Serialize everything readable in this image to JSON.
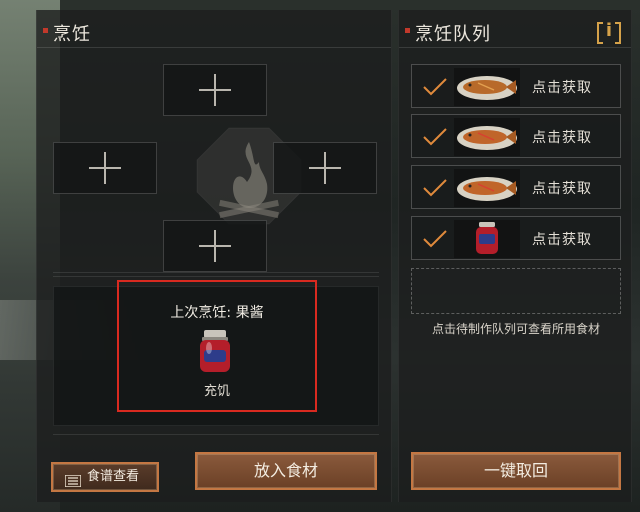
{
  "left_panel": {
    "title": "烹饪",
    "last_cooked_label": "上次烹饪: 果酱",
    "last_cooked_effect": "充饥",
    "recipe_button_label": "食谱查看",
    "add_ingredients_label": "放入食材"
  },
  "right_panel": {
    "title": "烹饪队列",
    "info_label": "i",
    "queue": [
      {
        "icon": "grilled-fish",
        "status": "done",
        "label": "点击获取"
      },
      {
        "icon": "grilled-fish",
        "status": "done",
        "label": "点击获取"
      },
      {
        "icon": "grilled-fish",
        "status": "done",
        "label": "点击获取"
      },
      {
        "icon": "jam-jar",
        "status": "done",
        "label": "点击获取"
      }
    ],
    "hint": "点击待制作队列可查看所用食材",
    "recall_all_label": "一键取回"
  },
  "colors": {
    "accent_orange": "#c47743",
    "check_orange": "#e08a3c",
    "highlight_red": "#d92a20",
    "info_gold": "#d5a24a"
  }
}
